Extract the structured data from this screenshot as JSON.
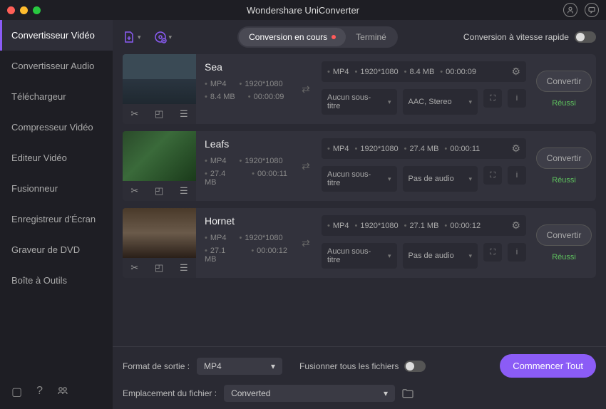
{
  "app": {
    "title": "Wondershare UniConverter"
  },
  "sidebar": {
    "items": [
      {
        "label": "Convertisseur Vidéo"
      },
      {
        "label": "Convertisseur Audio"
      },
      {
        "label": "Téléchargeur"
      },
      {
        "label": "Compresseur Vidéo"
      },
      {
        "label": "Editeur Vidéo"
      },
      {
        "label": "Fusionneur"
      },
      {
        "label": "Enregistreur d'Écran"
      },
      {
        "label": "Graveur de DVD"
      },
      {
        "label": "Boîte à Outils"
      }
    ]
  },
  "toolbar": {
    "tab_converting": "Conversion en cours",
    "tab_done": "Terminé",
    "speed_label": "Conversion à vitesse rapide"
  },
  "files": [
    {
      "name": "Sea",
      "fmt": "MP4",
      "res": "1920*1080",
      "size": "8.4 MB",
      "dur": "00:00:09",
      "out_fmt": "MP4",
      "out_res": "1920*1080",
      "out_size": "8.4 MB",
      "out_dur": "00:00:09",
      "subtitle": "Aucun sous-titre",
      "audio": "AAC, Stereo",
      "btn": "Convertir",
      "status": "Réussi"
    },
    {
      "name": "Leafs",
      "fmt": "MP4",
      "res": "1920*1080",
      "size": "27.4 MB",
      "dur": "00:00:11",
      "out_fmt": "MP4",
      "out_res": "1920*1080",
      "out_size": "27.4 MB",
      "out_dur": "00:00:11",
      "subtitle": "Aucun sous-titre",
      "audio": "Pas de audio",
      "btn": "Convertir",
      "status": "Réussi"
    },
    {
      "name": "Hornet",
      "fmt": "MP4",
      "res": "1920*1080",
      "size": "27.1 MB",
      "dur": "00:00:12",
      "out_fmt": "MP4",
      "out_res": "1920*1080",
      "out_size": "27.1 MB",
      "out_dur": "00:00:12",
      "subtitle": "Aucun sous-titre",
      "audio": "Pas de audio",
      "btn": "Convertir",
      "status": "Réussi"
    }
  ],
  "footer": {
    "format_label": "Format de sortie :",
    "format_value": "MP4",
    "merge_label": "Fusionner tous les fichiers",
    "location_label": "Emplacement du fichier :",
    "location_value": "Converted",
    "start_all": "Commencer Tout"
  }
}
